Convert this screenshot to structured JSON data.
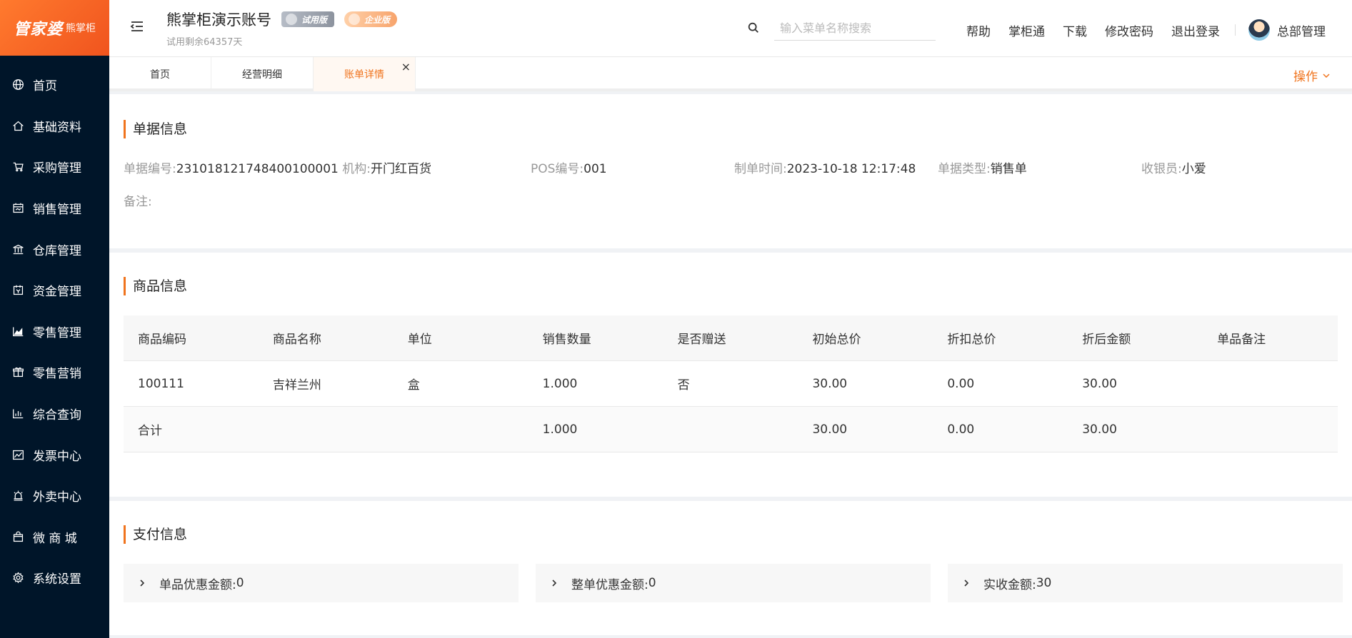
{
  "logo": {
    "brand": "管家婆",
    "sub": "熊掌柜"
  },
  "sidebar": {
    "items": [
      {
        "label": "首页",
        "icon": "globe-icon"
      },
      {
        "label": "基础资料",
        "icon": "home-icon"
      },
      {
        "label": "采购管理",
        "icon": "cart-icon"
      },
      {
        "label": "销售管理",
        "icon": "calendar-icon"
      },
      {
        "label": "仓库管理",
        "icon": "bank-icon"
      },
      {
        "label": "资金管理",
        "icon": "money-icon"
      },
      {
        "label": "零售管理",
        "icon": "area-chart-icon"
      },
      {
        "label": "零售营销",
        "icon": "gift-icon"
      },
      {
        "label": "综合查询",
        "icon": "bar-chart-icon"
      },
      {
        "label": "发票中心",
        "icon": "line-chart-icon"
      },
      {
        "label": "外卖中心",
        "icon": "alarm-icon"
      },
      {
        "label": "微 商 城",
        "icon": "bag-icon"
      },
      {
        "label": "系统设置",
        "icon": "gear-icon"
      }
    ]
  },
  "header": {
    "account_name": "熊掌柜演示账号",
    "badge_trial": "试用版",
    "badge_enterprise": "企业版",
    "trial_remaining": "试用剩余64357天",
    "search_placeholder": "输入菜单名称搜索",
    "links": {
      "help": "帮助",
      "zhanggui": "掌柜通",
      "download": "下载",
      "change_password": "修改密码",
      "logout": "退出登录"
    },
    "user_name": "总部管理"
  },
  "tabs": {
    "items": [
      {
        "label": "首页"
      },
      {
        "label": "经营明细"
      },
      {
        "label": "账单详情"
      }
    ],
    "close_symbol": "×",
    "operations": "操作"
  },
  "bill_info": {
    "title": "单据信息",
    "bill_no_label": "单据编号:",
    "bill_no": "231018121748400100001",
    "org_label": "机构:",
    "org": "开门红百货",
    "pos_label": "POS编号:",
    "pos": "001",
    "time_label": "制单时间:",
    "time": "2023-10-18 12:17:48",
    "type_label": "单据类型:",
    "type": "销售单",
    "cashier_label": "收银员:",
    "cashier": "小爱",
    "remark_label": "备注:"
  },
  "goods_info": {
    "title": "商品信息",
    "columns": [
      "商品编码",
      "商品名称",
      "单位",
      "销售数量",
      "是否赠送",
      "初始总价",
      "折扣总价",
      "折后金额",
      "单品备注"
    ],
    "rows": [
      [
        "100111",
        "吉祥兰州",
        "盒",
        "1.000",
        "否",
        "30.00",
        "0.00",
        "30.00",
        ""
      ]
    ],
    "total": [
      "合计",
      "",
      "",
      "1.000",
      "",
      "30.00",
      "0.00",
      "30.00",
      ""
    ]
  },
  "payment_info": {
    "title": "支付信息",
    "items": [
      {
        "label": "单品优惠金额:",
        "value": "0"
      },
      {
        "label": "整单优惠金额:",
        "value": "0"
      },
      {
        "label": "实收金额:",
        "value": "30"
      }
    ]
  },
  "colors": {
    "accent": "#f0741e",
    "sidebar_bg": "#001529"
  }
}
